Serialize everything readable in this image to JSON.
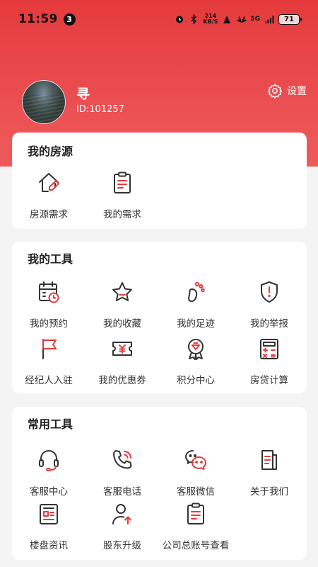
{
  "status_bar": {
    "time": "11:59",
    "notification_count": "3",
    "net_speed_value": "214",
    "net_speed_unit": "KB/S",
    "network": "5G",
    "battery": "71"
  },
  "profile": {
    "name": "寻",
    "id": "ID:101257",
    "settings_label": "设置"
  },
  "my_listings": {
    "title": "我的房源",
    "items": [
      {
        "label": "房源需求",
        "icon": "house-edit-icon"
      },
      {
        "label": "我的需求",
        "icon": "clipboard-icon"
      }
    ]
  },
  "my_tools": {
    "title": "我的工具",
    "items": [
      {
        "label": "我的预约",
        "icon": "calendar-clock-icon"
      },
      {
        "label": "我的收藏",
        "icon": "star-icon"
      },
      {
        "label": "我的足迹",
        "icon": "footprint-icon"
      },
      {
        "label": "我的举报",
        "icon": "shield-alert-icon"
      },
      {
        "label": "经纪人入驻",
        "icon": "flag-icon"
      },
      {
        "label": "我的优惠券",
        "icon": "coupon-icon"
      },
      {
        "label": "积分中心",
        "icon": "medal-icon"
      },
      {
        "label": "房贷计算",
        "icon": "calculator-icon"
      }
    ]
  },
  "common_tools": {
    "title": "常用工具",
    "items": [
      {
        "label": "客服中心",
        "icon": "headset-icon"
      },
      {
        "label": "客服电话",
        "icon": "phone-icon"
      },
      {
        "label": "客服微信",
        "icon": "wechat-icon"
      },
      {
        "label": "关于我们",
        "icon": "document-icon"
      },
      {
        "label": "楼盘资讯",
        "icon": "news-icon"
      },
      {
        "label": "股东升级",
        "icon": "user-upgrade-icon"
      },
      {
        "label": "公司总账号查看",
        "icon": "ledger-icon"
      }
    ]
  },
  "colors": {
    "brand_red": "#e53a3c",
    "icon_dark": "#333333",
    "icon_accent": "#e53a3c"
  }
}
